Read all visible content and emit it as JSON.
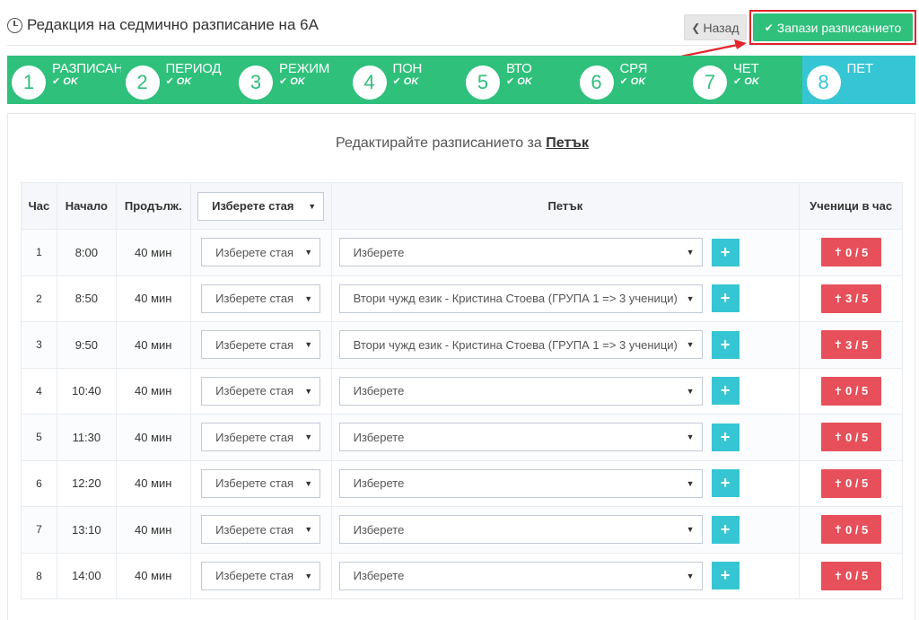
{
  "header": {
    "title": "Редакция на седмично разписание на 6А",
    "back_label": "Назад",
    "save_label": "Запази разписанието",
    "highlight_color": "#e3242b"
  },
  "steps": [
    {
      "num": "1",
      "label": "РАЗПИСАН",
      "status": "OK"
    },
    {
      "num": "2",
      "label": "ПЕРИОД",
      "status": "OK"
    },
    {
      "num": "3",
      "label": "РЕЖИМ",
      "status": "OK"
    },
    {
      "num": "4",
      "label": "ПОН",
      "status": "OK"
    },
    {
      "num": "5",
      "label": "ВТО",
      "status": "OK"
    },
    {
      "num": "6",
      "label": "СРЯ",
      "status": "OK"
    },
    {
      "num": "7",
      "label": "ЧЕТ",
      "status": "OK"
    },
    {
      "num": "8",
      "label": "ПЕТ",
      "status": ""
    }
  ],
  "content": {
    "subtitle_prefix": "Редактирайте разписанието за",
    "subtitle_day": "Петък"
  },
  "table": {
    "headers": {
      "hour": "Час",
      "start": "Начало",
      "duration": "Продълж.",
      "room": "Изберете стая",
      "day": "Петък",
      "students": "Ученици в час"
    },
    "rows": [
      {
        "hour": "1",
        "start": "8:00",
        "duration": "40 мин",
        "room": "Изберете стая",
        "subject": "Изберете",
        "students": "0 / 5"
      },
      {
        "hour": "2",
        "start": "8:50",
        "duration": "40 мин",
        "room": "Изберете стая",
        "subject": "Втори чужд език - Кристина Стоева (ГРУПА 1 => 3 ученици)",
        "students": "3 / 5"
      },
      {
        "hour": "3",
        "start": "9:50",
        "duration": "40 мин",
        "room": "Изберете стая",
        "subject": "Втори чужд език - Кристина Стоева (ГРУПА 1 => 3 ученици)",
        "students": "3 / 5"
      },
      {
        "hour": "4",
        "start": "10:40",
        "duration": "40 мин",
        "room": "Изберете стая",
        "subject": "Изберете",
        "students": "0 / 5"
      },
      {
        "hour": "5",
        "start": "11:30",
        "duration": "40 мин",
        "room": "Изберете стая",
        "subject": "Изберете",
        "students": "0 / 5"
      },
      {
        "hour": "6",
        "start": "12:20",
        "duration": "40 мин",
        "room": "Изберете стая",
        "subject": "Изберете",
        "students": "0 / 5"
      },
      {
        "hour": "7",
        "start": "13:10",
        "duration": "40 мин",
        "room": "Изберете стая",
        "subject": "Изберете",
        "students": "0 / 5"
      },
      {
        "hour": "8",
        "start": "14:00",
        "duration": "40 мин",
        "room": "Изберете стая",
        "subject": "Изберете",
        "students": "0 / 5"
      }
    ]
  },
  "icons": {
    "clock": "clock-icon",
    "back": "chevron-left-icon",
    "save": "check-icon",
    "add": "plus-icon",
    "students": "person-icon",
    "dropdown": "caret-down-icon"
  },
  "colors": {
    "success": "#2fc07c",
    "info": "#36c6d3",
    "danger": "#e7505a"
  }
}
